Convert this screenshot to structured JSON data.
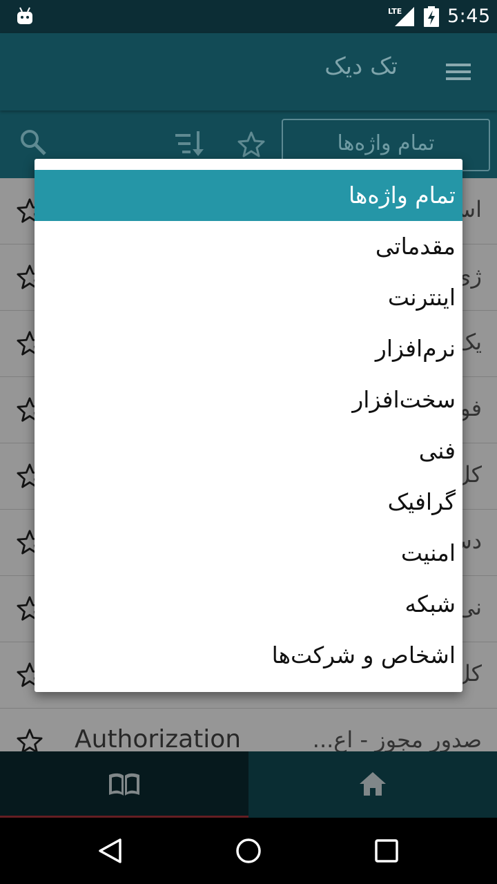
{
  "status_bar": {
    "time": "5:45",
    "network": "LTE"
  },
  "app_bar": {
    "title": "تک دیک"
  },
  "toolbar": {
    "selected_category": "تمام واژه‌ها"
  },
  "list_rows": [
    {
      "fa": "اس",
      "en": ""
    },
    {
      "fa": "ژئ",
      "en": ""
    },
    {
      "fa": "یک",
      "en": ""
    },
    {
      "fa": "فو",
      "en": ""
    },
    {
      "fa": "کل",
      "en": ""
    },
    {
      "fa": "دس",
      "en": ""
    },
    {
      "fa": "نی",
      "en": ""
    },
    {
      "fa": "کل",
      "en": ""
    },
    {
      "fa": "صدور مجوز - اع...",
      "en": "Authorization"
    }
  ],
  "dropdown": {
    "options": [
      "تمام واژه‌ها",
      "مقدماتی",
      "اینترنت",
      "نرم‌افزار",
      "سخت‌افزار",
      "فنی",
      "گرافیک",
      "امنیت",
      "شبکه",
      "اشخاص و شرکت‌ها"
    ],
    "selected_index": 0
  },
  "colors": {
    "status_bar": "#0c2d35",
    "app_bar": "#124b56",
    "selected_option": "#2596a7",
    "nav_indicator": "#a8333a"
  }
}
